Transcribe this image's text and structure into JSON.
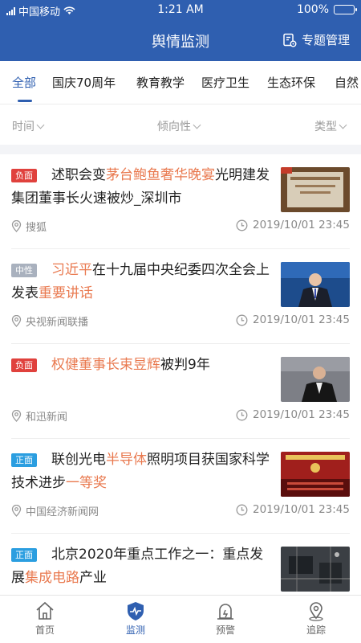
{
  "status_bar": {
    "carrier": "中国移动",
    "time": "1:21 AM",
    "battery": "100%"
  },
  "header": {
    "title": "舆情监测",
    "topic_management": "专题管理"
  },
  "tabs": [
    "全部",
    "国庆70周年",
    "教育教学",
    "医疗卫生",
    "生态环保",
    "自然"
  ],
  "filters": {
    "time": "时间",
    "sentiment": "倾向性",
    "type": "类型"
  },
  "articles": [
    {
      "badge": "负面",
      "parts": [
        "述职会变",
        "茅台鲍鱼奢华晚宴",
        "光明建发集团董事长火速被炒_深圳市",
        ""
      ],
      "source": "搜狐",
      "time": "2019/10/01 23:45"
    },
    {
      "badge": "中性",
      "parts": [
        "",
        "习近平",
        "在十九届中央纪委四次全会上发表",
        "重要讲话"
      ],
      "source": "央视新闻联播",
      "time": "2019/10/01 23:45"
    },
    {
      "badge": "负面",
      "parts": [
        "",
        "权健董事长束昱辉",
        "被判9年",
        ""
      ],
      "source": "和迅新闻",
      "time": "2019/10/01 23:45"
    },
    {
      "badge": "正面",
      "parts": [
        "联创光电",
        "半导体",
        "照明项目获国家科学技术进步",
        "一等奖"
      ],
      "source": "中国经济新闻网",
      "time": "2019/10/01 23:45"
    },
    {
      "badge": "正面",
      "parts": [
        "北京2020年重点工作之一：重点发展",
        "集成电路",
        "产业",
        ""
      ],
      "source": "",
      "time": ""
    }
  ],
  "bottom_nav": [
    "首页",
    "监测",
    "预警",
    "追踪"
  ],
  "colors": {
    "primary": "#2f5fb0",
    "negative": "#e0413d",
    "neutral": "#a9b1be",
    "positive": "#2b9ee0",
    "highlight": "#e9794f"
  }
}
